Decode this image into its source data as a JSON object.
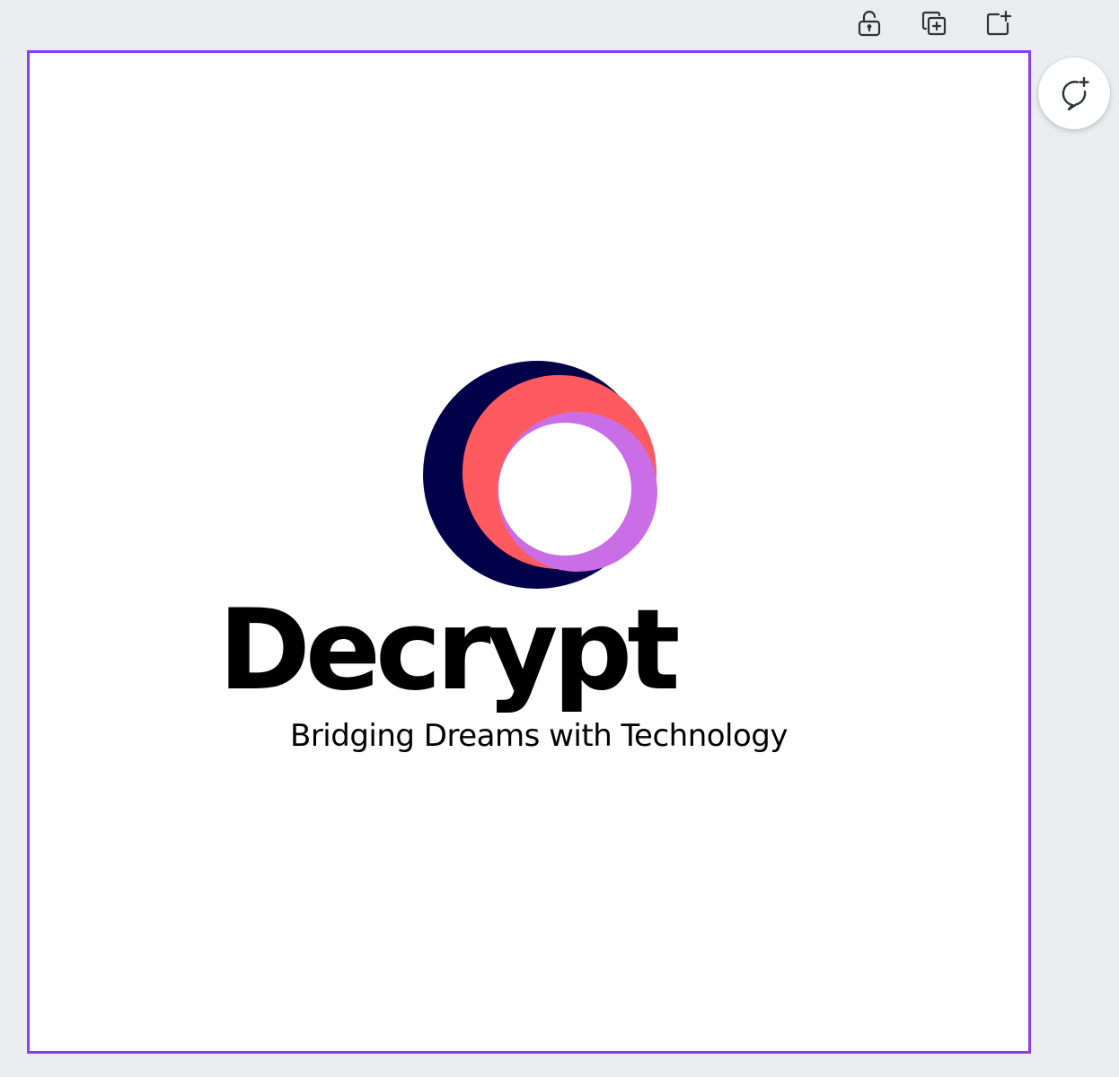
{
  "toolbar": {
    "lock_icon": "unlock-icon",
    "duplicate_icon": "duplicate-page-icon",
    "add_page_icon": "add-page-icon"
  },
  "comment": {
    "icon": "add-comment-icon"
  },
  "design": {
    "brand_name": "Decrypt",
    "tagline": "Bridging Dreams with Technology",
    "colors": {
      "navy": "#03004a",
      "coral": "#ff5a5f",
      "violet": "#c96ee6",
      "selection": "#8b3dff"
    }
  }
}
